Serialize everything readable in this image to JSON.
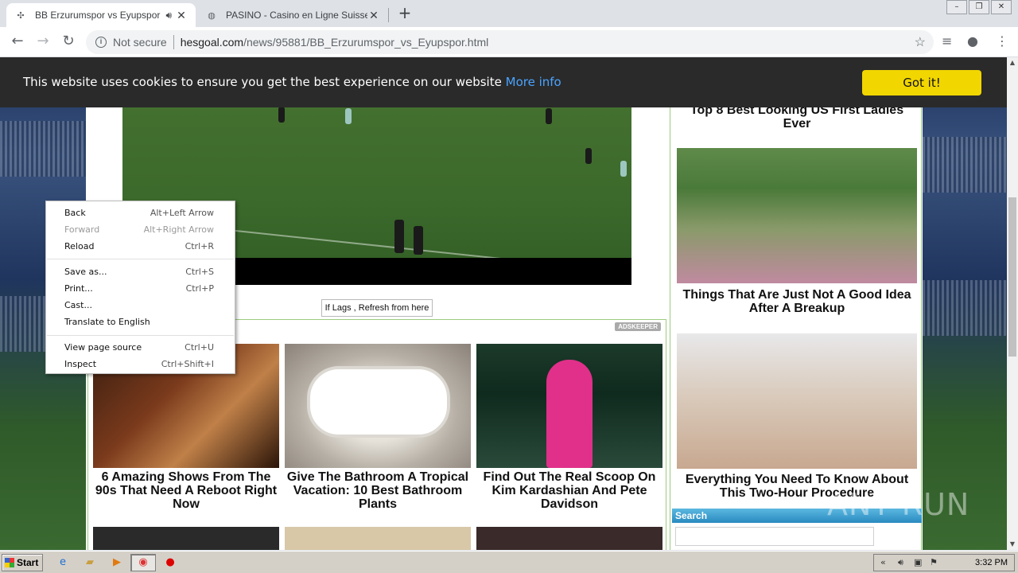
{
  "browser": {
    "tabs": [
      {
        "title": "BB Erzurumspor vs Eyupspor - H",
        "active": true,
        "audio": true
      },
      {
        "title": "PASINO - Casino en Ligne Suisse - Su",
        "active": false,
        "audio": false
      }
    ],
    "address": {
      "security_label": "Not secure",
      "host": "hesgoal.com",
      "path": "/news/95881/BB_Erzurumspor_vs_Eyupspor.html"
    }
  },
  "cookie_bar": {
    "message": "This website uses cookies to ensure you get the best experience on our website",
    "link_label": "More info",
    "button_label": "Got it!"
  },
  "video": {
    "refresh_label": "If Lags , Refresh from here"
  },
  "ads": {
    "provider_label": "ADSKEEPER",
    "items": [
      {
        "title": "6 Amazing Shows From The 90s That Need A Reboot Right Now"
      },
      {
        "title": "Give The Bathroom A Tropical Vacation: 10 Best Bathroom Plants"
      },
      {
        "title": "Find Out The Real Scoop On Kim Kardashian And Pete Davidson"
      }
    ]
  },
  "sidebar": {
    "items": [
      {
        "title": "Top 8 Best Looking US First Ladies Ever"
      },
      {
        "title": "Things That Are Just Not A Good Idea After A Breakup"
      },
      {
        "title": "Everything You Need To Know About This Two-Hour Procedure"
      }
    ],
    "search_heading": "Search",
    "search_value": ""
  },
  "context_menu": {
    "items": [
      {
        "label": "Back",
        "shortcut": "Alt+Left Arrow",
        "enabled": true
      },
      {
        "label": "Forward",
        "shortcut": "Alt+Right Arrow",
        "enabled": false
      },
      {
        "label": "Reload",
        "shortcut": "Ctrl+R",
        "enabled": true
      },
      {
        "label": "Save as...",
        "shortcut": "Ctrl+S",
        "enabled": true
      },
      {
        "label": "Print...",
        "shortcut": "Ctrl+P",
        "enabled": true
      },
      {
        "label": "Cast...",
        "shortcut": "",
        "enabled": true
      },
      {
        "label": "Translate to English",
        "shortcut": "",
        "enabled": true
      },
      {
        "label": "View page source",
        "shortcut": "Ctrl+U",
        "enabled": true
      },
      {
        "label": "Inspect",
        "shortcut": "Ctrl+Shift+I",
        "enabled": true
      }
    ]
  },
  "taskbar": {
    "start_label": "Start",
    "clock": "3:32 PM"
  },
  "watermark": "ANY RUN",
  "colors": {
    "cookie_button": "#f1d600",
    "cookie_link": "#4aa3ff",
    "ad_border": "#9ccc7f",
    "search_header": "#2a8ac0"
  },
  "icons": [
    "chrome-favicon",
    "audio-icon",
    "close-icon",
    "globe-favicon",
    "plus-icon",
    "back-arrow-icon",
    "forward-arrow-icon",
    "reload-icon",
    "info-icon",
    "star-icon",
    "media-icon",
    "profile-icon",
    "menu-dots-icon"
  ]
}
